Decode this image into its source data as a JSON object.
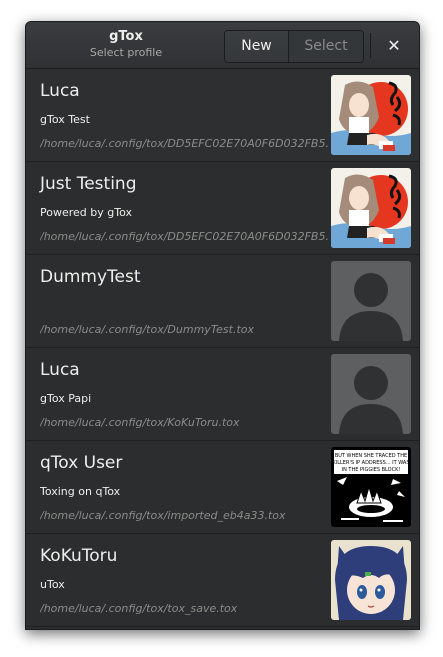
{
  "window": {
    "title": "gTox",
    "subtitle": "Select profile"
  },
  "toolbar": {
    "new_label": "New",
    "select_label": "Select",
    "close_glyph": "✕"
  },
  "profiles": [
    {
      "name": "Luca",
      "status": "gTox Test",
      "path": "/home/luca/.config/tox/DD5EFC02E70A0F6D032FB5...",
      "avatar": "anime-girl-avatar"
    },
    {
      "name": "Just Testing",
      "status": "Powered by gTox",
      "path": "/home/luca/.config/tox/DD5EFC02E70A0F6D032FB5...",
      "avatar": "anime-girl-avatar"
    },
    {
      "name": "DummyTest",
      "status": "",
      "path": "/home/luca/.config/tox/DummyTest.tox",
      "avatar": "default-person-avatar"
    },
    {
      "name": "Luca",
      "status": "gTox Papi",
      "path": "/home/luca/.config/tox/KoKuToru.tox",
      "avatar": "default-person-avatar"
    },
    {
      "name": "qTox User",
      "status": "Toxing on qTox",
      "path": "/home/luca/.config/tox/imported_eb4a33.tox",
      "avatar": "comic-panel-avatar"
    },
    {
      "name": "KoKuToru",
      "status": "uTox",
      "path": "/home/luca/.config/tox/tox_save.tox",
      "avatar": "catgirl-avatar"
    }
  ],
  "comic_text": [
    "BUT WHEN SHE TRACED THE",
    "KILLER'S IP ADDRESS... IT WAS",
    "IN THE PIGGIES BLOCK!"
  ]
}
